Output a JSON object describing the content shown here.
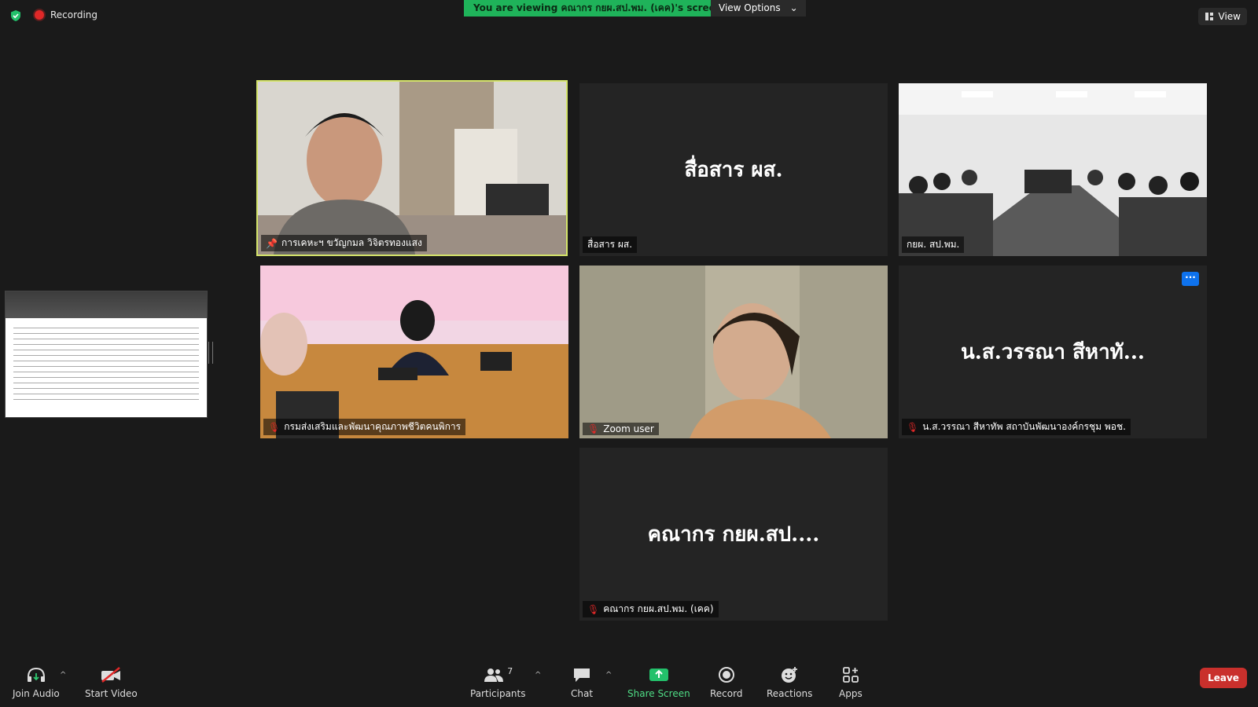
{
  "top": {
    "recording_label": "Recording",
    "viewing_banner": "You are viewing คณากร กยผ.สป.พม. (เคค)'s screen",
    "view_options": "View Options",
    "view_button": "View"
  },
  "tiles": {
    "t1": {
      "name": "การเคหะฯ ขวัญกมล วิจิตรทองแสง"
    },
    "t2": {
      "big": "สื่อสาร ผส.",
      "name": "สื่อสาร ผส."
    },
    "t3": {
      "name": "กยผ. สป.พม."
    },
    "t4": {
      "name": "กรมส่งเสริมและพัฒนาคุณภาพชีวิตคนพิการ"
    },
    "t5": {
      "name": "Zoom user"
    },
    "t6": {
      "big": "น.ส.วรรณา สีหาทั...",
      "name": "น.ส.วรรณา สีหาทัพ สถาบันพัฒนาองค์กรชุม พอช.",
      "more": "···"
    },
    "t7": {
      "big": "คณากร กยผ.สป....",
      "name": "คณากร กยผ.สป.พม. (เคค)"
    }
  },
  "toolbar": {
    "join_audio": "Join Audio",
    "start_video": "Start Video",
    "participants": "Participants",
    "participants_count": "7",
    "chat": "Chat",
    "share_screen": "Share Screen",
    "record": "Record",
    "reactions": "Reactions",
    "apps": "Apps",
    "leave": "Leave"
  },
  "colors": {
    "accent_green": "#1fb35a",
    "active_speaker": "#d4e46a",
    "leave_red": "#c9302c",
    "mute_red": "#e02828",
    "more_blue": "#0e72ed"
  }
}
